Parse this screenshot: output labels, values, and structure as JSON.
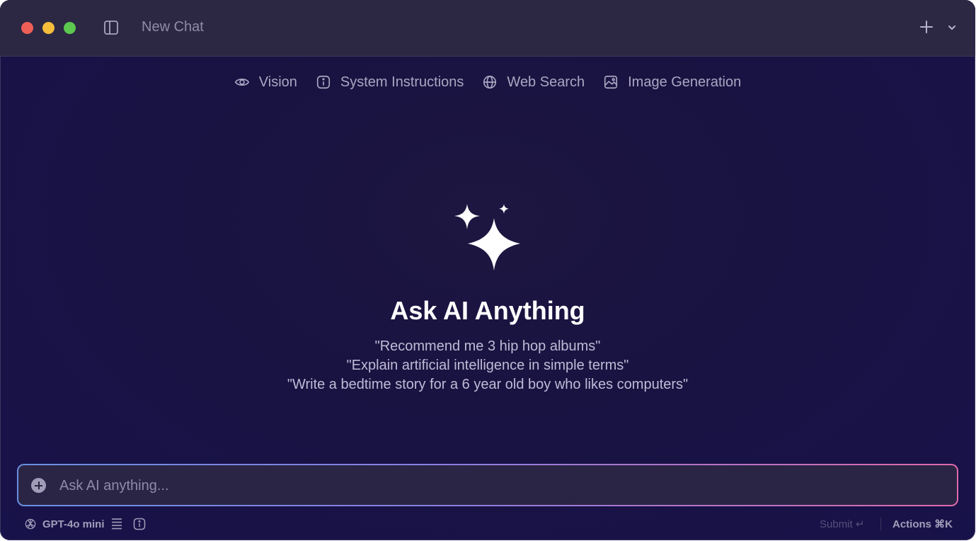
{
  "window": {
    "title": "New Chat"
  },
  "features": [
    {
      "label": "Vision",
      "icon": "eye-icon"
    },
    {
      "label": "System Instructions",
      "icon": "info-icon"
    },
    {
      "label": "Web Search",
      "icon": "globe-icon"
    },
    {
      "label": "Image Generation",
      "icon": "image-icon"
    }
  ],
  "hero": {
    "title": "Ask AI Anything",
    "examples": [
      "\"Recommend me 3 hip hop albums\"",
      "\"Explain artificial intelligence in simple terms\"",
      "\"Write a bedtime story for a 6 year old boy who likes computers\""
    ]
  },
  "input": {
    "placeholder": "Ask AI anything..."
  },
  "footer": {
    "model": "GPT-4o mini",
    "submit": "Submit ↵",
    "actions": "Actions ⌘K"
  },
  "colors": {
    "background": "#191342",
    "titlebar": "#2c2844",
    "gradient_start": "#6a8fe0",
    "gradient_end": "#e06aa8"
  }
}
